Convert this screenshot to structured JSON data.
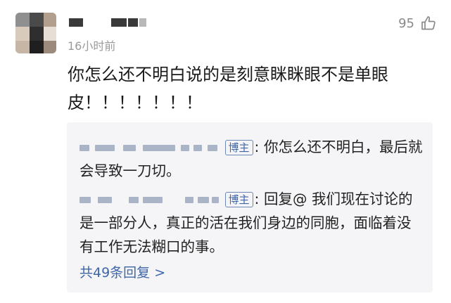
{
  "comment": {
    "time": "16小时前",
    "like_count": "95",
    "text": "你怎么还不明白说的是刻意眯眯眼不是单眼皮！！！！！！！"
  },
  "replies": {
    "items": [
      {
        "badge": "博主",
        "colon": ":",
        "text": "你怎么还不明白，最后就会导致一刀切。"
      },
      {
        "badge": "博主",
        "colon": ":",
        "text": "回复@                    我们现在讨论的是一部分人，真正的活在我们身边的同胞，面临着没有工作无法糊口的事。"
      }
    ],
    "more_label": "共49条回复 >"
  },
  "colors": {
    "link": "#3e66a8",
    "badge_border": "#6b88b6",
    "reply_bg": "#f5f5f7"
  },
  "icons": {
    "like": "thumbs-up-icon"
  }
}
